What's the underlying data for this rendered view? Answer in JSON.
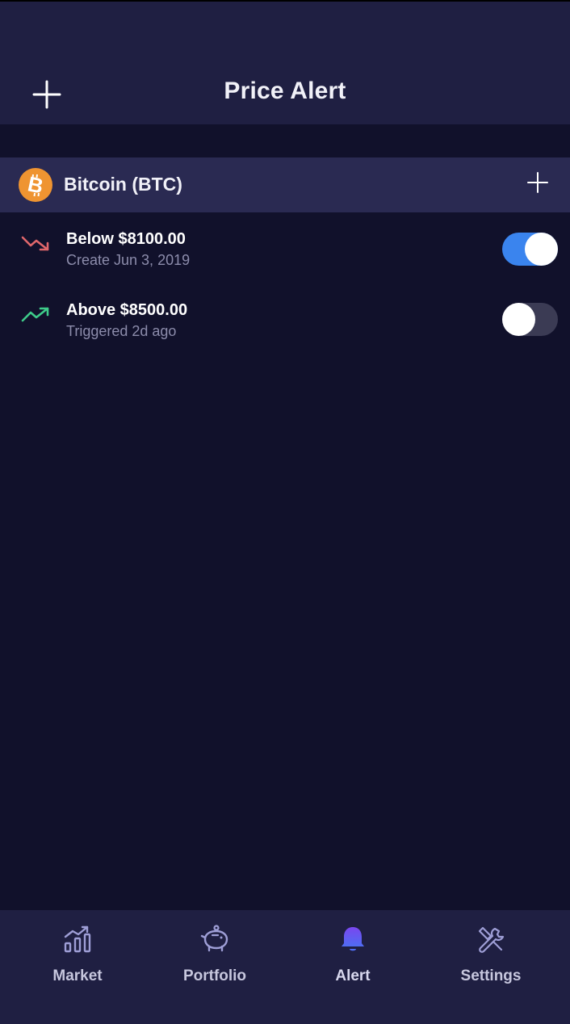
{
  "header": {
    "title": "Price Alert",
    "add_icon": "plus-icon"
  },
  "coin": {
    "name": "Bitcoin (BTC)",
    "logo_icon": "bitcoin-icon",
    "logo_color": "#ef9431",
    "add_icon": "plus-icon"
  },
  "alerts": [
    {
      "title": "Below $8100.00",
      "subtitle": "Create Jun 3, 2019",
      "trend_icon": "trend-down-icon",
      "trend_color": "#e0676b",
      "enabled": true
    },
    {
      "title": "Above $8500.00",
      "subtitle": "Triggered 2d ago",
      "trend_icon": "trend-up-icon",
      "trend_color": "#3ecb8a",
      "enabled": false
    }
  ],
  "nav": {
    "items": [
      {
        "label": "Market",
        "icon": "chart-bars-icon",
        "active": false
      },
      {
        "label": "Portfolio",
        "icon": "piggy-bank-icon",
        "active": false
      },
      {
        "label": "Alert",
        "icon": "bell-icon",
        "active": true
      },
      {
        "label": "Settings",
        "icon": "tools-icon",
        "active": false
      }
    ]
  },
  "colors": {
    "background": "#11112b",
    "header": "#1f1f42",
    "section": "#2a2a52",
    "toggle_on": "#3a84ee",
    "toggle_off": "#3b3b54",
    "muted_text": "#8c8cab",
    "active_icon": "#6b4df0"
  }
}
